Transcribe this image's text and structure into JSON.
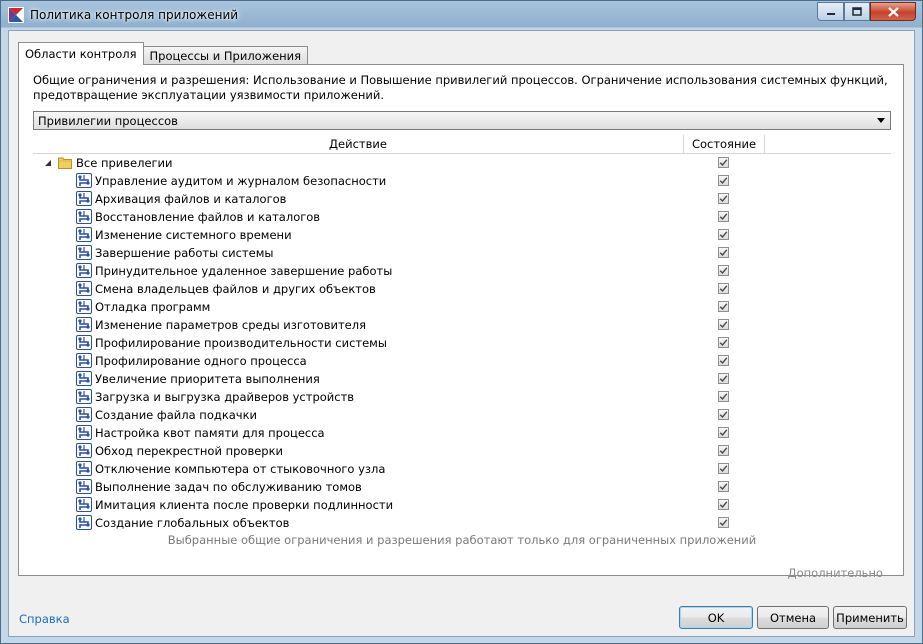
{
  "window": {
    "title": "Политика контроля приложений",
    "accent_color": "#8fb0cf",
    "close_color": "#c5432a"
  },
  "tabs": [
    {
      "label": "Области контроля",
      "active": true
    },
    {
      "label": "Процессы и Приложения",
      "active": false
    }
  ],
  "panel": {
    "description": "Общие ограничения и разрешения: Использование и Повышение привилегий процессов. Ограничение использования системных функций, предотвращение эксплуатации уязвимости приложений.",
    "dropdown_value": "Привилегии процессов",
    "columns": {
      "action": "Действие",
      "state": "Состояние"
    },
    "root": {
      "label": "Все привелегии",
      "checked": true,
      "icon": "folder-icon"
    },
    "items": [
      {
        "label": "Управление аудитом и журналом безопасности",
        "checked": true
      },
      {
        "label": "Архивация файлов и каталогов",
        "checked": true
      },
      {
        "label": "Восстановление файлов и каталогов",
        "checked": true
      },
      {
        "label": "Изменение системного времени",
        "checked": true
      },
      {
        "label": "Завершение работы системы",
        "checked": true
      },
      {
        "label": "Принудительное удаленное завершение работы",
        "checked": true
      },
      {
        "label": "Смена владельцев файлов и других объектов",
        "checked": true
      },
      {
        "label": "Отладка программ",
        "checked": true
      },
      {
        "label": "Изменение параметров среды изготовителя",
        "checked": true
      },
      {
        "label": "Профилирование производительности системы",
        "checked": true
      },
      {
        "label": "Профилирование одного процесса",
        "checked": true
      },
      {
        "label": "Увеличение приоритета выполнения",
        "checked": true
      },
      {
        "label": "Загрузка и выгрузка драйверов устройств",
        "checked": true
      },
      {
        "label": "Создание файла подкачки",
        "checked": true
      },
      {
        "label": "Настройка квот памяти для процесса",
        "checked": true
      },
      {
        "label": "Обход перекрестной проверки",
        "checked": true
      },
      {
        "label": "Отключение компьютера от стыковочного узла",
        "checked": true
      },
      {
        "label": "Выполнение задач по обслуживанию томов",
        "checked": true
      },
      {
        "label": "Имитация клиента после проверки подлинности",
        "checked": true
      },
      {
        "label": "Создание глобальных объектов",
        "checked": true
      }
    ],
    "footer_note": "Выбранные общие ограничения и разрешения работают только для ограниченных приложений"
  },
  "more_link": "Дополнительно",
  "help_link": "Справка",
  "buttons": {
    "ok": "OK",
    "cancel": "Отмена",
    "apply": "Применить"
  }
}
